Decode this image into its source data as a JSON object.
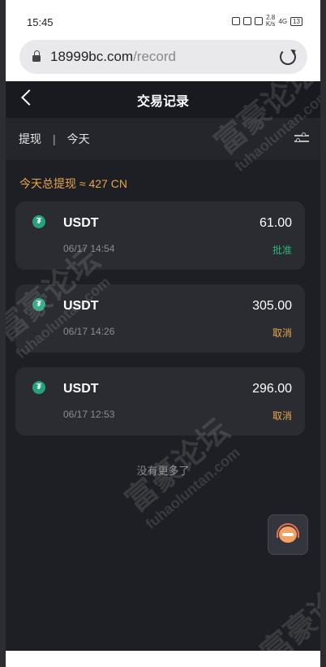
{
  "status_bar": {
    "time": "15:45",
    "net_speed": "2.8\nK/s",
    "signal": "4G",
    "battery": "13"
  },
  "browser": {
    "url_host": "18999bc.com",
    "url_path": "/record"
  },
  "header": {
    "title": "交易记录"
  },
  "filters": {
    "type": "提现",
    "separator": "|",
    "period": "今天"
  },
  "summary": "今天总提现 ≈ 427 CN",
  "records": [
    {
      "coin": "USDT",
      "time": "06/17 14:54",
      "amount": "61.00",
      "status": "批准",
      "status_color": "#2bb673"
    },
    {
      "coin": "USDT",
      "time": "06/17 14:26",
      "amount": "305.00",
      "status": "取消",
      "status_color": "#e8a64a"
    },
    {
      "coin": "USDT",
      "time": "06/17 12:53",
      "amount": "296.00",
      "status": "取消",
      "status_color": "#e8a64a"
    }
  ],
  "no_more": "没有更多了",
  "watermark": {
    "text": "富豪论坛",
    "sub": "fuhaoluntan.com"
  },
  "colors": {
    "accent_orange": "#e8a64a",
    "approve_green": "#2bb673",
    "tether_green": "#26a17b"
  },
  "icons": {
    "back": "chevron-left-icon",
    "filter": "sliders-icon",
    "coin": "tether-icon",
    "support": "customer-service-icon"
  }
}
